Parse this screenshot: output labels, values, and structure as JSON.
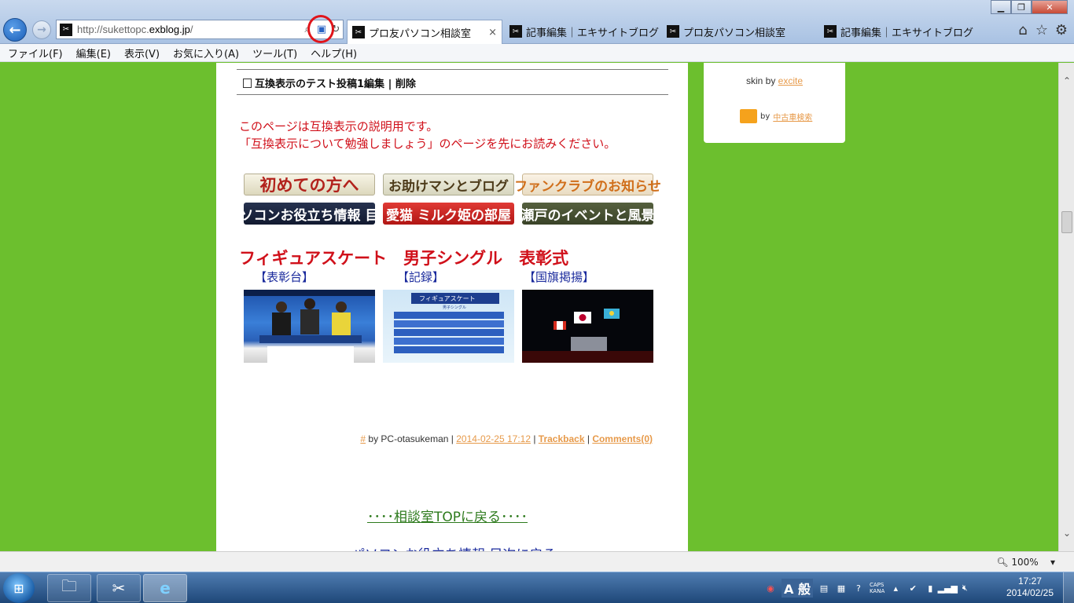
{
  "browser": {
    "address_url_prefix": "http://sukettopc.",
    "address_url_domain": "exblog.jp",
    "address_url_suffix": "/",
    "tabs": [
      {
        "title": "プロ友パソコン相談室",
        "active": true
      },
      {
        "title": "記事編集｜エキサイトブログ",
        "active": false
      },
      {
        "title": "プロ友パソコン相談室",
        "active": false
      },
      {
        "title": "記事編集｜エキサイトブログ",
        "active": false
      }
    ],
    "menu": [
      "ファイル(F)",
      "編集(E)",
      "表示(V)",
      "お気に入り(A)",
      "ツール(T)",
      "ヘルプ(H)"
    ]
  },
  "post": {
    "title": "互換表示のテスト投稿1編集",
    "delete_label": "削除",
    "intro_line1": "このページは互換表示の説明用です。",
    "intro_line2": "「互換表示について勉強しましょう」のページを先にお読みください。",
    "banners": [
      "初めての方へ",
      "お助けマンとブログ",
      "ファンクラブのお知らせ",
      "パソコンお役立ち情報 目次",
      "愛猫 ミルク姫の部屋",
      "瀬戸のイベントと風景"
    ],
    "skate_title": "フィギュアスケート　男子シングル　表彰式",
    "skate_sub": [
      "【表彰台】",
      "【記録】",
      "【国旗掲揚】"
    ],
    "record_card_title": "フィギュアスケート",
    "record_card_sub": "男子シングル",
    "byline": {
      "hash": "#",
      "by": "by PC-otasukeman |",
      "datetime": "2014-02-25 17:12",
      "trackback": "Trackback",
      "comments": "Comments(0)"
    },
    "back_top": "････相談室TOPに戻る････",
    "next_link": "パソコンお役立ち情報 目次に戻る"
  },
  "sidebar": {
    "skin_by": "skin by",
    "skin_link": "excite",
    "truck_by": "by",
    "truck_link": "中古車検索"
  },
  "status": {
    "zoom": "100%"
  },
  "taskbar": {
    "ime_mode": "A 般",
    "caps": "CAPS",
    "kana": "KANA",
    "time": "17:27",
    "date": "2014/02/25"
  }
}
